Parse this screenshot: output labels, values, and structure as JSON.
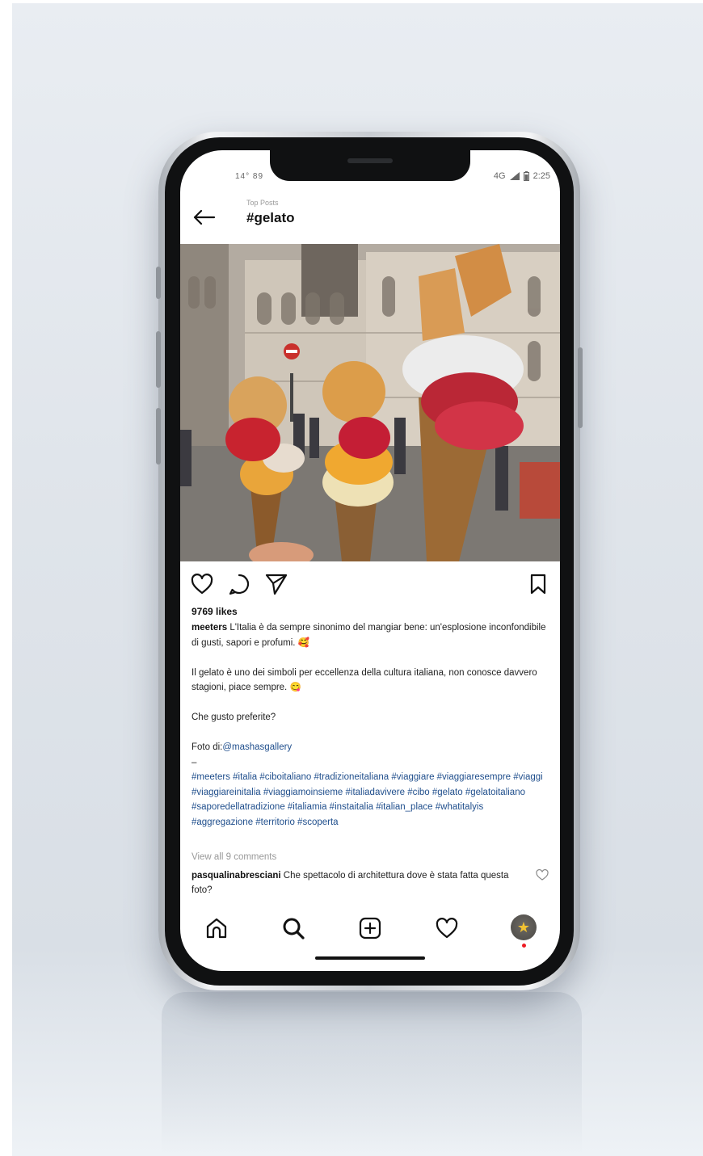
{
  "status_bar": {
    "left": "14° 89",
    "network": "4G",
    "time": "2:25"
  },
  "header": {
    "subtitle": "Top Posts",
    "title": "#gelato",
    "back_icon": "arrow-left-icon"
  },
  "post": {
    "photo_alt": "three gelato cones in front of Florence cathedral",
    "likes": "9769 likes",
    "author": "meeters",
    "caption_line1": " L'Italia è da sempre sinonimo del mangiar bene: un'esplosione inconfondibile di gusti, sapori e profumi. 🥰",
    "caption_para2": "Il gelato è uno dei simboli per eccellenza della cultura italiana, non conosce davvero stagioni, piace sempre. 😋",
    "caption_para3": "Che gusto preferite?",
    "photo_credit_prefix": "Foto di:",
    "photo_credit_user": "@mashasgallery",
    "dash": "–",
    "hashtags": "#meeters #italia #ciboitaliano #tradizioneitaliana #viaggiare #viaggiaresempre #viaggi #viaggiareinitalia #viaggiamoinsieme #italiadavivere #cibo #gelato #gelatoitaliano #saporedellatradizione #italiamia #instaitalia #italian_place #whatitalyis #aggregazione #territorio #scoperta",
    "view_comments": "View all 9 comments",
    "comment_user": "pasqualinabresciani",
    "comment_text": " Che spettacolo di architettura dove è  stata fatta questa foto?"
  },
  "actions": {
    "like_icon": "heart-icon",
    "comment_icon": "comment-icon",
    "share_icon": "paper-plane-icon",
    "save_icon": "bookmark-icon"
  },
  "tabbar": {
    "items": [
      "home-icon",
      "search-icon",
      "add-post-icon",
      "activity-heart-icon",
      "profile-avatar"
    ],
    "avatar_glyph": "★"
  },
  "colors": {
    "link": "#1f4e8c",
    "text": "#222222",
    "muted": "#999999",
    "notification": "#ed1c24"
  }
}
